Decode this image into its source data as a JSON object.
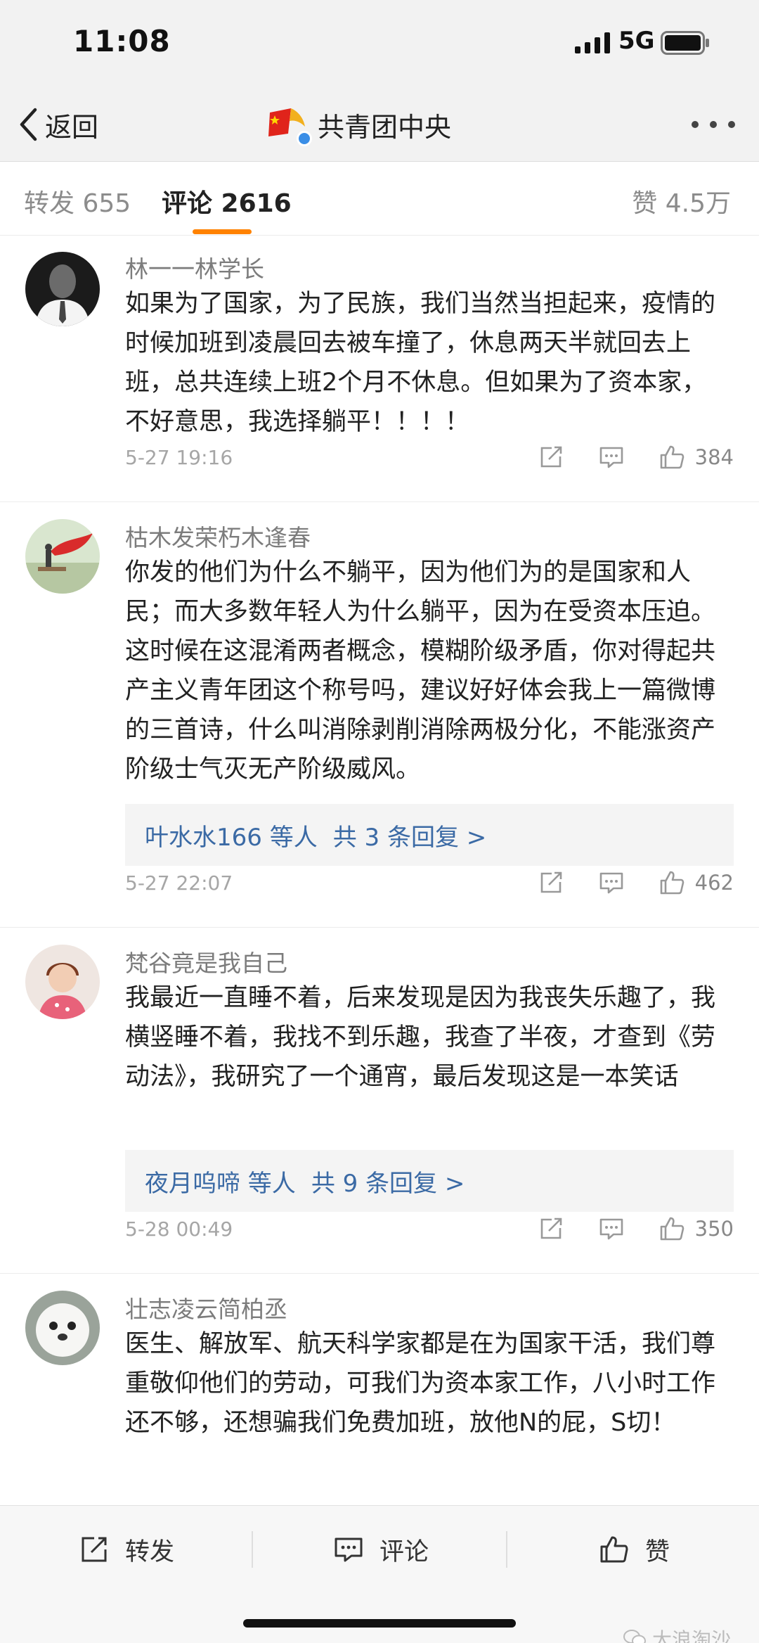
{
  "status_bar": {
    "time": "11:08",
    "network": "5G"
  },
  "nav": {
    "back_label": "返回",
    "title": "共青团中央"
  },
  "tabs": {
    "repost": "转发 655",
    "comment": "评论 2616",
    "like": "赞 4.5万"
  },
  "comments": [
    {
      "username": "林一一林学长",
      "text": "如果为了国家，为了民族，我们当然当担起来，疫情的时候加班到凌晨回去被车撞了，休息两天半就回去上班，总共连续上班2个月不休息。但如果为了资本家，不好意思，我选择躺平！！！！",
      "time": "5-27 19:16",
      "likes": "384"
    },
    {
      "username": "枯木发荣朽木逢春",
      "text": "你发的他们为什么不躺平，因为他们为的是国家和人民；而大多数年轻人为什么躺平，因为在受资本压迫。这时候在这混淆两者概念，模糊阶级矛盾，你对得起共产主义青年团这个称号吗，建议好好体会我上一篇微博的三首诗，什么叫消除剥削消除两极分化，不能涨资产阶级士气灭无产阶级威风。",
      "replies_users": "叶水水166 等人",
      "replies_count": "共 3 条回复 >",
      "time": "5-27 22:07",
      "likes": "462"
    },
    {
      "username": "梵谷竟是我自己",
      "text": "我最近一直睡不着，后来发现是因为我丧失乐趣了，我横竖睡不着，我找不到乐趣，我查了半夜，才查到《劳动法》，我研究了一个通宵，最后发现这是一本笑话",
      "replies_users": "夜月呜啼 等人",
      "replies_count": "共 9 条回复 >",
      "time": "5-28 00:49",
      "likes": "350"
    },
    {
      "username": "壮志凌云简柏丞",
      "text": "医生、解放军、航天科学家都是在为国家干活，我们尊重敬仰他们的劳动，可我们为资本家工作，八小时工作还不够，还想骗我们免费加班，放他N的屁，S切！"
    }
  ],
  "bottom_bar": {
    "repost": "转发",
    "comment": "评论",
    "like": "赞"
  },
  "watermark": "大浪淘沙",
  "colors": {
    "accent": "#ff8200",
    "link": "#3b6aa5",
    "verified": "#3a8ee6"
  }
}
